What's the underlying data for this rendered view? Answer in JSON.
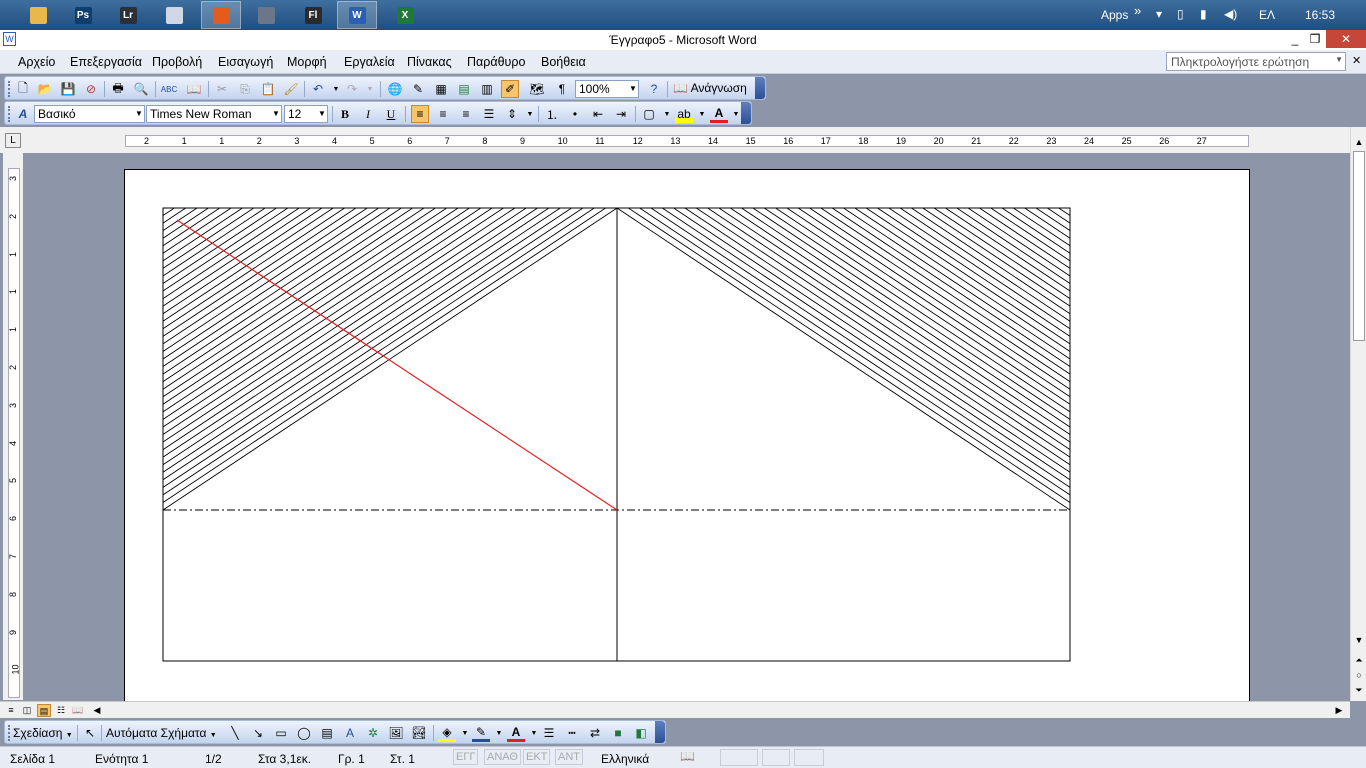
{
  "taskbar": {
    "apps": [
      {
        "name": "file-explorer",
        "label": "",
        "color": "#e8b84a",
        "active": false
      },
      {
        "name": "photoshop",
        "label": "Ps",
        "color": "#0f3d6e",
        "active": false
      },
      {
        "name": "lightroom",
        "label": "Lr",
        "color": "#2a2f3a",
        "active": false
      },
      {
        "name": "calculator",
        "label": "",
        "color": "#cfd8e4",
        "active": false
      },
      {
        "name": "firefox",
        "label": "",
        "color": "#e55b1c",
        "active": true
      },
      {
        "name": "settings",
        "label": "",
        "color": "#6b7688",
        "active": false
      },
      {
        "name": "flash",
        "label": "Fl",
        "color": "#2b2b2b",
        "active": false
      },
      {
        "name": "word",
        "label": "W",
        "color": "#2b5fb4",
        "active": true
      },
      {
        "name": "excel",
        "label": "X",
        "color": "#1f7a3a",
        "active": false
      }
    ],
    "apps_label": "Apps",
    "chevron": "»",
    "language": "ΕΛ",
    "clock": "16:53"
  },
  "window": {
    "title": "Έγγραφο5 - Microsoft Word",
    "min": "_",
    "max": "❐",
    "close": "✕"
  },
  "menu": {
    "items": [
      "Αρχείο",
      "Επεξεργασία",
      "Προβολή",
      "Εισαγωγή",
      "Μορφή",
      "Εργαλεία",
      "Πίνακας",
      "Παράθυρο",
      "Βοήθεια"
    ],
    "help_placeholder": "Πληκτρολογήστε ερώτηση",
    "doc_close": "✕"
  },
  "standard_toolbar": {
    "zoom": "100%",
    "reading_label": "Ανάγνωση"
  },
  "format_toolbar": {
    "style": "Βασικό",
    "font": "Times New Roman",
    "size": "12",
    "bold": "B",
    "italic": "I",
    "underline": "U"
  },
  "ruler": {
    "numbers": [
      "2",
      "1",
      "1",
      "2",
      "3",
      "4",
      "5",
      "6",
      "7",
      "8",
      "9",
      "10",
      "11",
      "12",
      "13",
      "14",
      "15",
      "16",
      "17",
      "18",
      "19",
      "20",
      "21",
      "22",
      "23",
      "24",
      "25",
      "26",
      "27"
    ],
    "vertical_numbers": [
      "3",
      "2",
      "1",
      "1",
      "1",
      "2",
      "3",
      "4",
      "5",
      "6",
      "7",
      "8",
      "9",
      "10"
    ],
    "corner": "L"
  },
  "drawing_toolbar": {
    "draw_label": "Σχεδίαση",
    "autoshapes_label": "Αυτόματα Σχήματα"
  },
  "status": {
    "page": "Σελίδα 1",
    "section": "Ενότητα 1",
    "pages": "1/2",
    "at": "Στα 3,1εκ.",
    "line": "Γρ. 1",
    "col": "Στ. 1",
    "rec": "ΕΓΓ",
    "trk": "ΑΝΑΘ",
    "ext": "ΕΚΤ",
    "ovr": "ΑΝΤ",
    "language": "Ελληνικά"
  },
  "drawing": {
    "line_color": "#000000",
    "diagonal_color": "#e02020"
  }
}
